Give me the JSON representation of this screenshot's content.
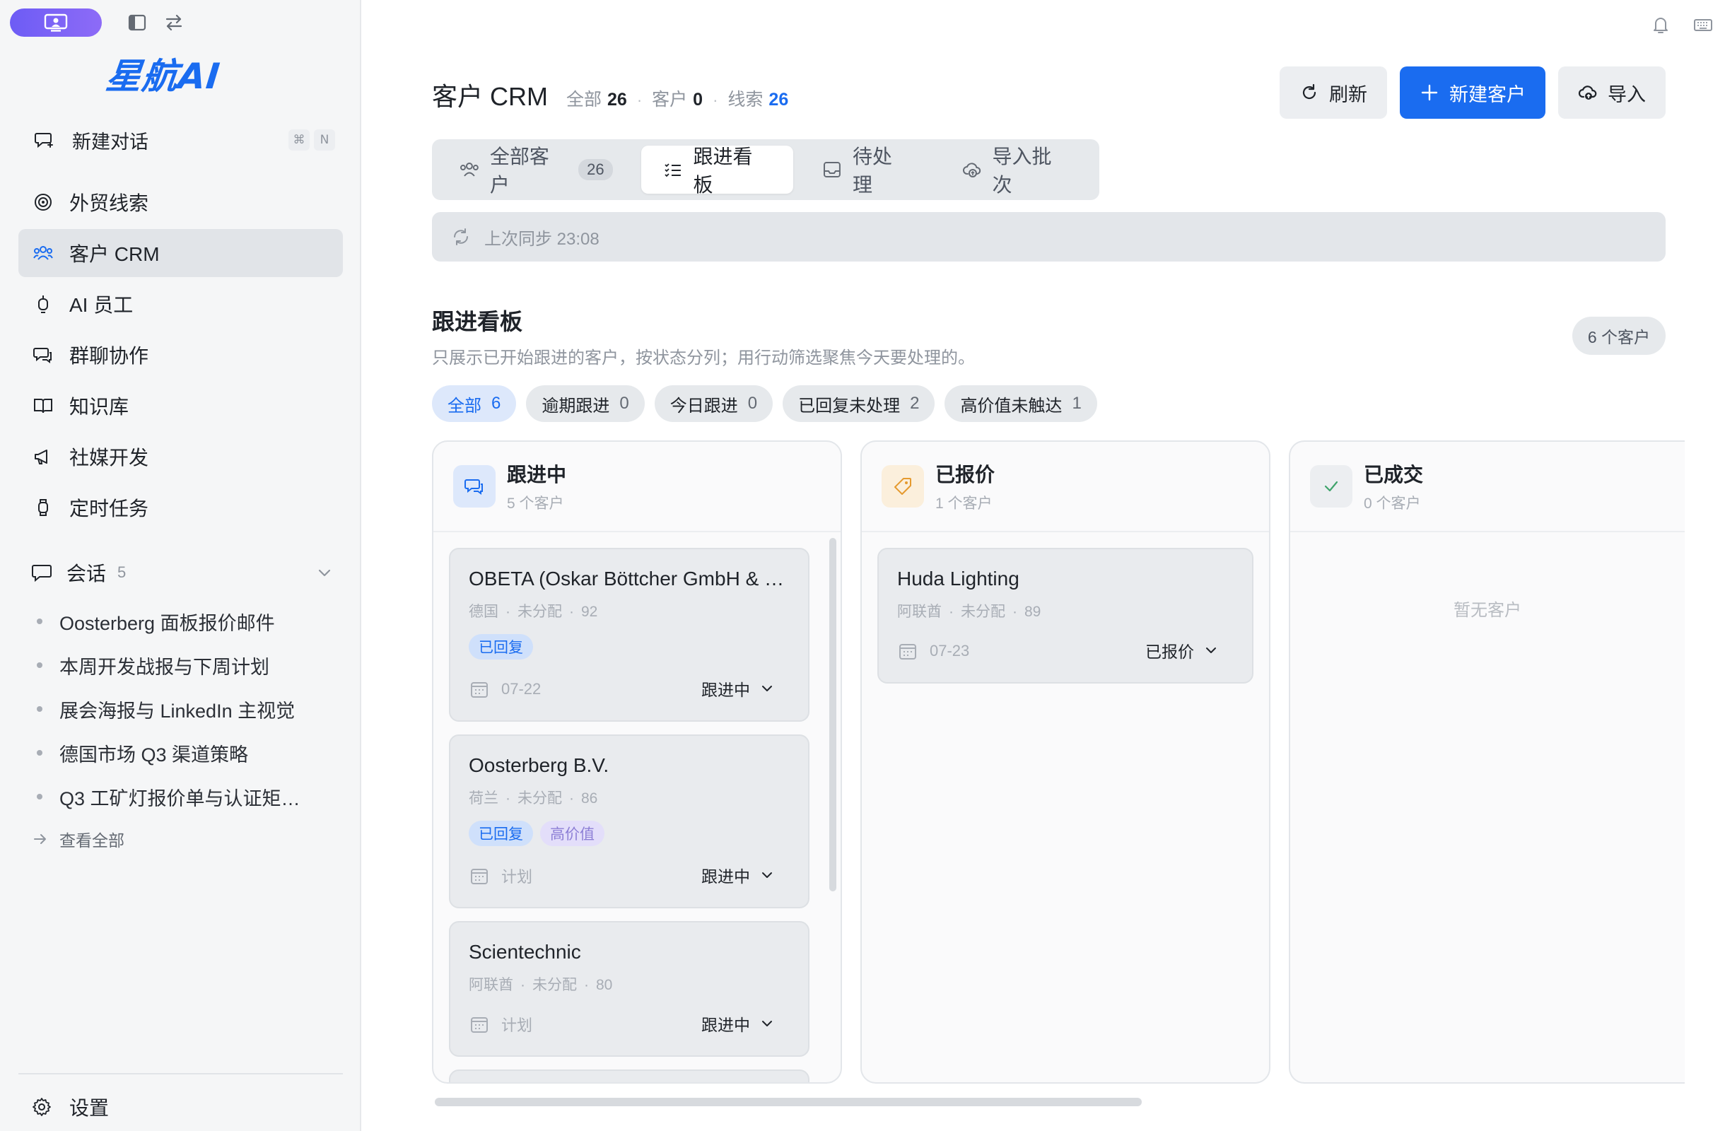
{
  "sidebar": {
    "logo_text": "星航AI",
    "new_chat": {
      "label": "新建对话",
      "shortcut": [
        "⌘",
        "N"
      ]
    },
    "nav": [
      {
        "label": "外贸线索",
        "icon": "target-icon"
      },
      {
        "label": "客户 CRM",
        "icon": "people-icon",
        "active": true
      },
      {
        "label": "AI 员工",
        "icon": "robot-icon"
      },
      {
        "label": "群聊协作",
        "icon": "chat-icon"
      },
      {
        "label": "知识库",
        "icon": "book-icon"
      },
      {
        "label": "社媒开发",
        "icon": "megaphone-icon"
      },
      {
        "label": "定时任务",
        "icon": "watch-icon"
      }
    ],
    "conversations": {
      "label": "会话",
      "count": "5",
      "items": [
        "Oosterberg 面板报价邮件",
        "本周开发战报与下周计划",
        "展会海报与 LinkedIn 主视觉",
        "德国市场 Q3 渠道策略",
        "Q3 工矿灯报价单与认证矩…"
      ],
      "view_all": "查看全部"
    },
    "settings": "设置"
  },
  "header": {
    "title": "客户 CRM",
    "stats": {
      "all_label": "全部",
      "all": "26",
      "customers_label": "客户",
      "customers": "0",
      "leads_label": "线索",
      "leads": "26"
    },
    "actions": {
      "refresh": "刷新",
      "new_customer": "新建客户",
      "import": "导入"
    }
  },
  "tabs": [
    {
      "label": "全部客户",
      "badge": "26"
    },
    {
      "label": "跟进看板",
      "active": true
    },
    {
      "label": "待处理"
    },
    {
      "label": "导入批次"
    }
  ],
  "sync": {
    "text": "上次同步 23:08"
  },
  "board": {
    "title": "跟进看板",
    "description": "只展示已开始跟进的客户，按状态分列；用行动筛选聚焦今天要处理的。",
    "count_pill": "6 个客户",
    "filters": [
      {
        "label": "全部",
        "count": "6",
        "active": true
      },
      {
        "label": "逾期跟进",
        "count": "0"
      },
      {
        "label": "今日跟进",
        "count": "0"
      },
      {
        "label": "已回复未处理",
        "count": "2"
      },
      {
        "label": "高价值未触达",
        "count": "1"
      }
    ],
    "columns": [
      {
        "name": "跟进中",
        "count": "5 个客户",
        "icon": "chat-icon",
        "icon_bg": "#dde8fb",
        "icon_color": "#1a6cf0",
        "cards": [
          {
            "name": "OBETA (Oskar Böttcher GmbH & C…",
            "country": "德国",
            "owner": "未分配",
            "score": "92",
            "tags": [
              {
                "text": "已回复",
                "style": "blue"
              }
            ],
            "date": "07-22",
            "status": "跟进中"
          },
          {
            "name": "Oosterberg B.V.",
            "country": "荷兰",
            "owner": "未分配",
            "score": "86",
            "tags": [
              {
                "text": "已回复",
                "style": "blue"
              },
              {
                "text": "高价值",
                "style": "purple"
              }
            ],
            "date": "计划",
            "status": "跟进中"
          },
          {
            "name": "Scientechnic",
            "country": "阿联酋",
            "owner": "未分配",
            "score": "80",
            "tags": [],
            "date": "计划",
            "status": "跟进中"
          }
        ]
      },
      {
        "name": "已报价",
        "count": "1 个客户",
        "icon": "tag-icon",
        "icon_bg": "#fbefdc",
        "icon_color": "#e59a2f",
        "cards": [
          {
            "name": "Huda Lighting",
            "country": "阿联酋",
            "owner": "未分配",
            "score": "89",
            "tags": [],
            "date": "07-23",
            "status": "已报价"
          }
        ]
      },
      {
        "name": "已成交",
        "count": "0 个客户",
        "icon": "check-icon",
        "icon_bg": "#eceef1",
        "icon_color": "#3fa36b",
        "empty": "暂无客户",
        "cards": []
      }
    ]
  }
}
